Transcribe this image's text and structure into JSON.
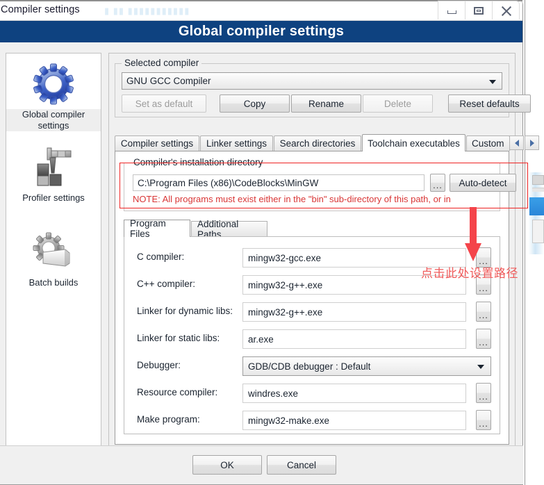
{
  "window": {
    "title": "Compiler settings",
    "header": "Global compiler settings",
    "minimize_label": "Minimize",
    "maximize_label": "Restore",
    "close_label": "Close"
  },
  "sidebar": {
    "items": [
      {
        "label": "Global compiler settings",
        "icon": "gear-icon",
        "selected": true
      },
      {
        "label": "Profiler settings",
        "icon": "caliper-icon",
        "selected": false
      },
      {
        "label": "Batch builds",
        "icon": "gear-stack-icon",
        "selected": false
      }
    ]
  },
  "selected_compiler": {
    "group_title": "Selected compiler",
    "combo_value": "GNU GCC Compiler",
    "buttons": [
      {
        "label": "Set as default",
        "disabled": true
      },
      {
        "label": "Copy",
        "disabled": false
      },
      {
        "label": "Rename",
        "disabled": false
      },
      {
        "label": "Delete",
        "disabled": true
      },
      {
        "label": "Reset defaults",
        "disabled": false
      }
    ]
  },
  "tabs": {
    "items": [
      {
        "label": "Compiler settings",
        "active": false
      },
      {
        "label": "Linker settings",
        "active": false
      },
      {
        "label": "Search directories",
        "active": false
      },
      {
        "label": "Toolchain executables",
        "active": true
      },
      {
        "label": "Custom",
        "active": false
      }
    ],
    "nav_prev": "◀",
    "nav_next": "▶"
  },
  "install_dir": {
    "group_title": "Compiler's installation directory",
    "path_value": "C:\\Program Files (x86)\\CodeBlocks\\MinGW",
    "browse_label": "...",
    "auto_detect_label": "Auto-detect",
    "note": "NOTE: All programs must exist either in the \"bin\" sub-directory of this path, or in"
  },
  "inner_tabs": {
    "items": [
      {
        "label": "Program Files",
        "active": true
      },
      {
        "label": "Additional Paths",
        "active": false
      }
    ]
  },
  "program_files": {
    "browse_label": "...",
    "rows": [
      {
        "label": "C compiler:",
        "value": "mingw32-gcc.exe",
        "type": "text"
      },
      {
        "label": "C++ compiler:",
        "value": "mingw32-g++.exe",
        "type": "text"
      },
      {
        "label": "Linker for dynamic libs:",
        "value": "mingw32-g++.exe",
        "type": "text"
      },
      {
        "label": "Linker for static libs:",
        "value": "ar.exe",
        "type": "text"
      },
      {
        "label": "Debugger:",
        "value": "GDB/CDB debugger : Default",
        "type": "combo"
      },
      {
        "label": "Resource compiler:",
        "value": "windres.exe",
        "type": "text"
      },
      {
        "label": "Make program:",
        "value": "mingw32-make.exe",
        "type": "text"
      }
    ]
  },
  "annotation": {
    "text": "点击此处设置路径",
    "color": "#f05a5a"
  },
  "footer": {
    "ok_label": "OK",
    "cancel_label": "Cancel"
  },
  "colors": {
    "header_blue": "#0e4280",
    "annotation_red": "#ee2222",
    "note_red": "#d93636"
  }
}
